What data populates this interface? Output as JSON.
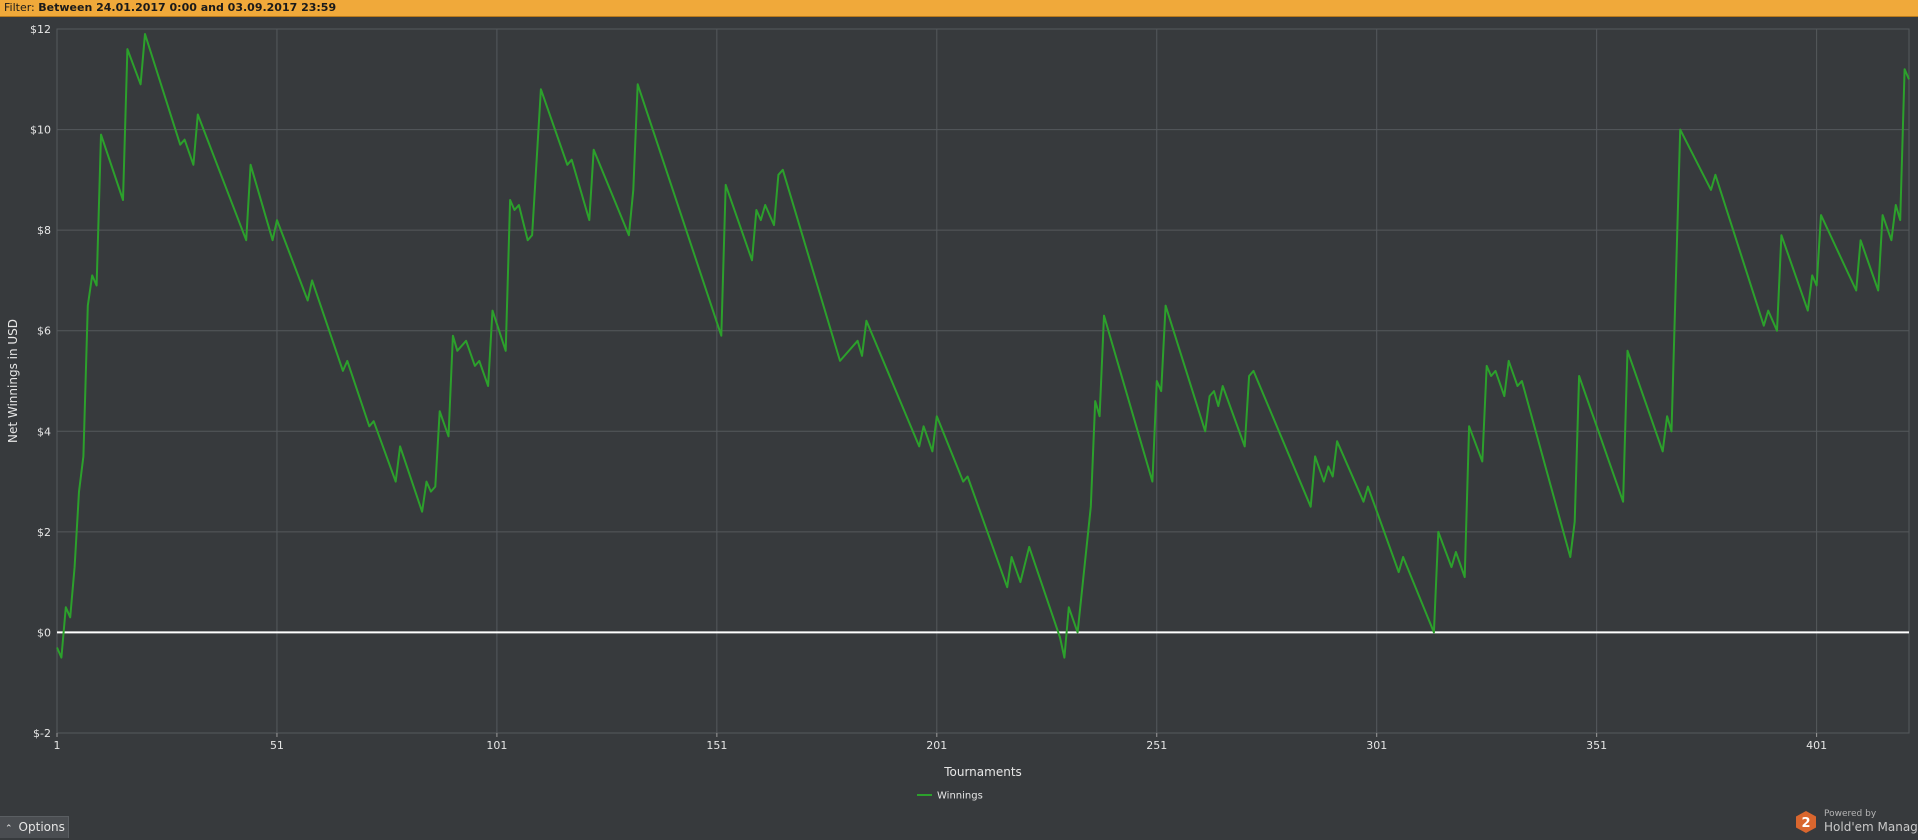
{
  "filter": {
    "prefix": "Filter:",
    "value": "Between 24.01.2017 0:00 and 03.09.2017 23:59"
  },
  "options_label": "Options",
  "brand": {
    "powered_by": "Powered by",
    "product": "Hold'em Manager",
    "logo_text": "2"
  },
  "colors": {
    "background": "#373a3d",
    "filter_bar": "#f0a93a",
    "series_line": "#2ca02c",
    "zero_line": "#ffffff",
    "grid": "#55595d",
    "logo": "#d9662e"
  },
  "chart_data": {
    "type": "line",
    "title": "",
    "xlabel": "Tournaments",
    "ylabel": "Net Winnings in USD",
    "xlim": [
      1,
      422
    ],
    "ylim": [
      -2,
      12
    ],
    "x_ticks": [
      1,
      51,
      101,
      151,
      201,
      251,
      301,
      351,
      401
    ],
    "y_ticks": [
      {
        "value": -2,
        "label": "$-2"
      },
      {
        "value": 0,
        "label": "$0"
      },
      {
        "value": 2,
        "label": "$2"
      },
      {
        "value": 4,
        "label": "$4"
      },
      {
        "value": 6,
        "label": "$6"
      },
      {
        "value": 8,
        "label": "$8"
      },
      {
        "value": 10,
        "label": "$10"
      },
      {
        "value": 12,
        "label": "$12"
      }
    ],
    "grid": true,
    "zero_line": true,
    "legend": {
      "position": "bottom-center"
    },
    "series": [
      {
        "name": "Winnings",
        "points": [
          [
            1,
            -0.3
          ],
          [
            2,
            -0.5
          ],
          [
            3,
            0.5
          ],
          [
            4,
            0.3
          ],
          [
            5,
            1.3
          ],
          [
            6,
            2.8
          ],
          [
            7,
            3.5
          ],
          [
            8,
            6.5
          ],
          [
            9,
            7.1
          ],
          [
            10,
            6.9
          ],
          [
            11,
            9.9
          ],
          [
            16,
            8.6
          ],
          [
            17,
            11.6
          ],
          [
            20,
            10.9
          ],
          [
            21,
            11.9
          ],
          [
            29,
            9.7
          ],
          [
            30,
            9.8
          ],
          [
            32,
            9.3
          ],
          [
            33,
            10.3
          ],
          [
            44,
            7.8
          ],
          [
            45,
            9.3
          ],
          [
            50,
            7.8
          ],
          [
            51,
            8.2
          ],
          [
            58,
            6.6
          ],
          [
            59,
            7.0
          ],
          [
            66,
            5.2
          ],
          [
            67,
            5.4
          ],
          [
            72,
            4.1
          ],
          [
            73,
            4.2
          ],
          [
            78,
            3.0
          ],
          [
            79,
            3.7
          ],
          [
            84,
            2.4
          ],
          [
            85,
            3.0
          ],
          [
            86,
            2.8
          ],
          [
            87,
            2.9
          ],
          [
            88,
            4.4
          ],
          [
            90,
            3.9
          ],
          [
            91,
            5.9
          ],
          [
            92,
            5.6
          ],
          [
            94,
            5.8
          ],
          [
            96,
            5.3
          ],
          [
            97,
            5.4
          ],
          [
            99,
            4.9
          ],
          [
            100,
            6.4
          ],
          [
            103,
            5.6
          ],
          [
            104,
            8.6
          ],
          [
            105,
            8.4
          ],
          [
            106,
            8.5
          ],
          [
            108,
            7.8
          ],
          [
            109,
            7.9
          ],
          [
            111,
            10.8
          ],
          [
            117,
            9.3
          ],
          [
            118,
            9.4
          ],
          [
            122,
            8.2
          ],
          [
            123,
            9.6
          ],
          [
            131,
            7.9
          ],
          [
            132,
            8.8
          ],
          [
            133,
            10.9
          ],
          [
            152,
            5.9
          ],
          [
            153,
            8.9
          ],
          [
            159,
            7.4
          ],
          [
            160,
            8.4
          ],
          [
            161,
            8.2
          ],
          [
            162,
            8.5
          ],
          [
            164,
            8.1
          ],
          [
            165,
            9.1
          ],
          [
            166,
            9.2
          ],
          [
            179,
            5.4
          ],
          [
            183,
            5.8
          ],
          [
            184,
            5.5
          ],
          [
            185,
            6.2
          ],
          [
            197,
            3.7
          ],
          [
            198,
            4.1
          ],
          [
            200,
            3.6
          ],
          [
            201,
            4.3
          ],
          [
            207,
            3.0
          ],
          [
            208,
            3.1
          ],
          [
            217,
            0.9
          ],
          [
            218,
            1.5
          ],
          [
            220,
            1.0
          ],
          [
            222,
            1.7
          ],
          [
            229,
            -0.1
          ],
          [
            230,
            -0.5
          ],
          [
            231,
            0.5
          ],
          [
            233,
            0.0
          ],
          [
            236,
            2.5
          ],
          [
            237,
            4.6
          ],
          [
            238,
            4.3
          ],
          [
            239,
            6.3
          ],
          [
            250,
            3.0
          ],
          [
            251,
            5.0
          ],
          [
            252,
            4.8
          ],
          [
            253,
            6.5
          ],
          [
            262,
            4.0
          ],
          [
            263,
            4.7
          ],
          [
            264,
            4.8
          ],
          [
            265,
            4.5
          ],
          [
            266,
            4.9
          ],
          [
            271,
            3.7
          ],
          [
            272,
            5.1
          ],
          [
            273,
            5.2
          ],
          [
            286,
            2.5
          ],
          [
            287,
            3.5
          ],
          [
            289,
            3.0
          ],
          [
            290,
            3.3
          ],
          [
            291,
            3.1
          ],
          [
            292,
            3.8
          ],
          [
            298,
            2.6
          ],
          [
            299,
            2.9
          ],
          [
            306,
            1.2
          ],
          [
            307,
            1.5
          ],
          [
            314,
            0.0
          ],
          [
            315,
            2.0
          ],
          [
            318,
            1.3
          ],
          [
            319,
            1.6
          ],
          [
            321,
            1.1
          ],
          [
            322,
            4.1
          ],
          [
            325,
            3.4
          ],
          [
            326,
            5.3
          ],
          [
            327,
            5.1
          ],
          [
            328,
            5.2
          ],
          [
            330,
            4.7
          ],
          [
            331,
            5.4
          ],
          [
            333,
            4.9
          ],
          [
            334,
            5.0
          ],
          [
            345,
            1.5
          ],
          [
            346,
            2.2
          ],
          [
            347,
            5.1
          ],
          [
            357,
            2.6
          ],
          [
            358,
            5.6
          ],
          [
            366,
            3.6
          ],
          [
            367,
            4.3
          ],
          [
            368,
            4.0
          ],
          [
            370,
            10.0
          ],
          [
            377,
            8.8
          ],
          [
            378,
            9.1
          ],
          [
            389,
            6.1
          ],
          [
            390,
            6.4
          ],
          [
            392,
            6.0
          ],
          [
            393,
            7.9
          ],
          [
            399,
            6.4
          ],
          [
            400,
            7.1
          ],
          [
            401,
            6.9
          ],
          [
            402,
            8.3
          ],
          [
            410,
            6.8
          ],
          [
            411,
            7.8
          ],
          [
            415,
            6.8
          ],
          [
            416,
            8.3
          ],
          [
            418,
            7.8
          ],
          [
            419,
            8.5
          ],
          [
            420,
            8.2
          ],
          [
            421,
            11.2
          ],
          [
            422,
            11.0
          ]
        ]
      }
    ]
  }
}
